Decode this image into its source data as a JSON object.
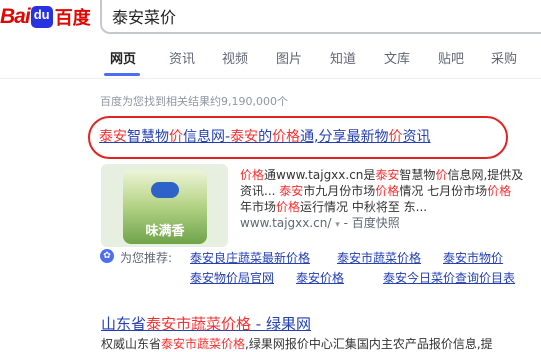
{
  "logo": {
    "bai": "Bai",
    "du_mark": "du",
    "du_text": "百度"
  },
  "search": {
    "query": "泰安菜价"
  },
  "tabs": [
    {
      "label": "网页",
      "active": true
    },
    {
      "label": "资讯"
    },
    {
      "label": "视频"
    },
    {
      "label": "图片"
    },
    {
      "label": "知道"
    },
    {
      "label": "文库"
    },
    {
      "label": "贴吧"
    },
    {
      "label": "采购"
    }
  ],
  "result_count": "百度为您找到相关结果约9,190,000个",
  "result1": {
    "title": {
      "p1": "泰安",
      "p2": "智慧物",
      "p3": "价",
      "p4": "信息网-",
      "p5": "泰安",
      "p6": "的",
      "p7": "价格",
      "p8": "通,分享最新物",
      "p9": "价",
      "p10": "资讯"
    },
    "image_text": "味满香",
    "snippet": {
      "l1": {
        "a": "价格",
        "b": "通www.tajgxx.cn是",
        "c": "泰安",
        "d": "智慧物",
        "e": "价",
        "f": "信息网,提供及"
      },
      "l2": {
        "a": "资讯... ",
        "b": "泰安",
        "c": "市九月份市场",
        "d": "价格",
        "e": "情况 七月份市场",
        "f": "价格"
      },
      "l3": {
        "a": "年市场",
        "b": "价格",
        "c": "运行情况 中秋将至 东..."
      }
    },
    "url": "www.tajgxx.cn/",
    "dropdown": "▾",
    "separator": " - ",
    "snapshot": "百度快照"
  },
  "recommend": {
    "label": "为您推荐:",
    "links": [
      "泰安良庄蔬菜最新价格",
      "泰安市蔬菜价格",
      "泰安市物价",
      "泰安物价局官网",
      "泰安价格",
      "泰安今日菜价查询价目表"
    ]
  },
  "result2": {
    "title": {
      "a": "山东省",
      "b": "泰安市蔬菜价格",
      "c": " - 绿果网"
    },
    "snippet": {
      "a": "权威山东省",
      "b": "泰安市蔬菜价格",
      "c": ",绿果网报价中心汇集国内主农产品报价信息,提"
    }
  },
  "colors": {
    "link": "#2440b3",
    "highlight": "#f73131",
    "annotation_oval": "#e02424",
    "tab_accent": "#4e6ef2"
  }
}
